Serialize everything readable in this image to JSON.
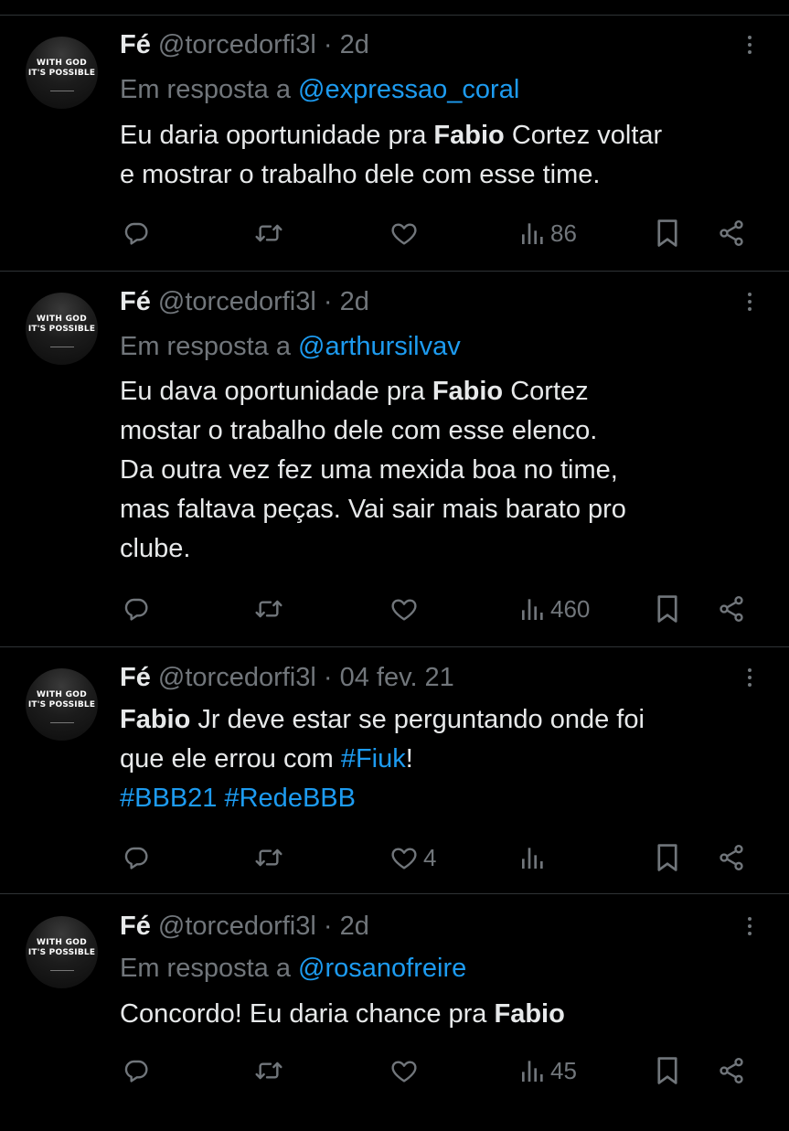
{
  "tweets": [
    {
      "name": "Fé",
      "handle": "@torcedorfi3l",
      "time": "2d",
      "reply_prefix": "Em resposta a",
      "reply_to": "@expressao_coral",
      "lines": [
        [
          {
            "t": "Eu daria oportunidade pra "
          },
          {
            "t": "Fabio",
            "b": true
          },
          {
            "t": " Cortez voltar"
          }
        ],
        [
          {
            "t": "e mostrar o trabalho dele com esse time."
          }
        ]
      ],
      "views": "86",
      "likes": ""
    },
    {
      "name": "Fé",
      "handle": "@torcedorfi3l",
      "time": "2d",
      "reply_prefix": "Em resposta a",
      "reply_to": "@arthursilvav",
      "lines": [
        [
          {
            "t": "Eu dava oportunidade pra "
          },
          {
            "t": "Fabio",
            "b": true
          },
          {
            "t": " Cortez"
          }
        ],
        [
          {
            "t": "mostar o trabalho dele com esse elenco."
          }
        ],
        [
          {
            "t": "Da outra vez fez uma mexida boa no time,"
          }
        ],
        [
          {
            "t": "mas faltava peças. Vai sair mais barato pro"
          }
        ],
        [
          {
            "t": "clube."
          }
        ]
      ],
      "views": "460",
      "likes": ""
    },
    {
      "name": "Fé",
      "handle": "@torcedorfi3l",
      "time": "04 fev. 21",
      "reply_prefix": "",
      "reply_to": "",
      "lines": [
        [
          {
            "t": "Fabio",
            "b": true
          },
          {
            "t": " Jr deve estar se perguntando onde foi"
          }
        ],
        [
          {
            "t": "que ele errou com "
          },
          {
            "t": "#Fiuk",
            "l": true
          },
          {
            "t": "!"
          }
        ],
        [
          {
            "t": "#BBB21",
            "l": true
          },
          {
            "t": " "
          },
          {
            "t": "#RedeBBB",
            "l": true
          }
        ]
      ],
      "views": "",
      "likes": "4"
    },
    {
      "name": "Fé",
      "handle": "@torcedorfi3l",
      "time": "2d",
      "reply_prefix": "Em resposta a",
      "reply_to": "@rosanofreire",
      "lines": [
        [
          {
            "t": "Concordo! Eu daria chance pra "
          },
          {
            "t": "Fabio",
            "b": true
          }
        ]
      ],
      "views": "45",
      "likes": ""
    }
  ],
  "avatar_text": {
    "line1": "WITH GOD",
    "line2": "IT'S POSSIBLE"
  },
  "colors": {
    "background": "#000000",
    "text": "#e7e9ea",
    "muted": "#71767b",
    "link": "#1d9bf0",
    "divider": "#2f3336"
  },
  "icons": [
    "reply-icon",
    "retweet-icon",
    "like-icon",
    "views-icon",
    "bookmark-icon",
    "share-icon",
    "more-icon"
  ]
}
